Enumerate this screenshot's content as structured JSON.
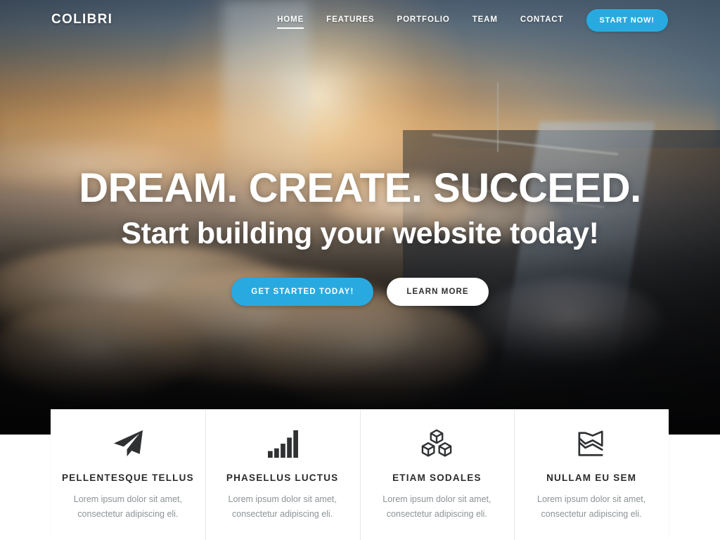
{
  "nav": {
    "logo": "COLIBRI",
    "links": [
      {
        "label": "HOME",
        "active": true
      },
      {
        "label": "FEATURES",
        "active": false
      },
      {
        "label": "PORTFOLIO",
        "active": false
      },
      {
        "label": "TEAM",
        "active": false
      },
      {
        "label": "CONTACT",
        "active": false
      }
    ],
    "cta_label": "START NOW!",
    "cta_color": "#28aae1"
  },
  "hero": {
    "title": "DREAM. CREATE. SUCCEED.",
    "subtitle": "Start building your website today!",
    "primary_button": "GET STARTED TODAY!",
    "secondary_button": "LEARN MORE",
    "primary_color": "#28aae1",
    "secondary_color": "#ffffff",
    "background_description": "aerial-cityscape-sunset-photo"
  },
  "features": {
    "cards": [
      {
        "icon": "paper-plane-icon",
        "title": "PELLENTESQUE TELLUS",
        "text": "Lorem ipsum dolor sit amet, consectetur adipiscing eli."
      },
      {
        "icon": "bar-chart-icon",
        "title": "PHASELLUS LUCTUS",
        "text": "Lorem ipsum dolor sit amet, consectetur adipiscing eli."
      },
      {
        "icon": "cubes-icon",
        "title": "ETIAM SODALES",
        "text": "Lorem ipsum dolor sit amet, consectetur adipiscing eli."
      },
      {
        "icon": "area-chart-icon",
        "title": "NULLAM EU SEM",
        "text": "Lorem ipsum dolor sit amet, consectetur adipiscing eli."
      }
    ],
    "title_color": "#2b2b2b",
    "text_color": "#8c9396"
  }
}
